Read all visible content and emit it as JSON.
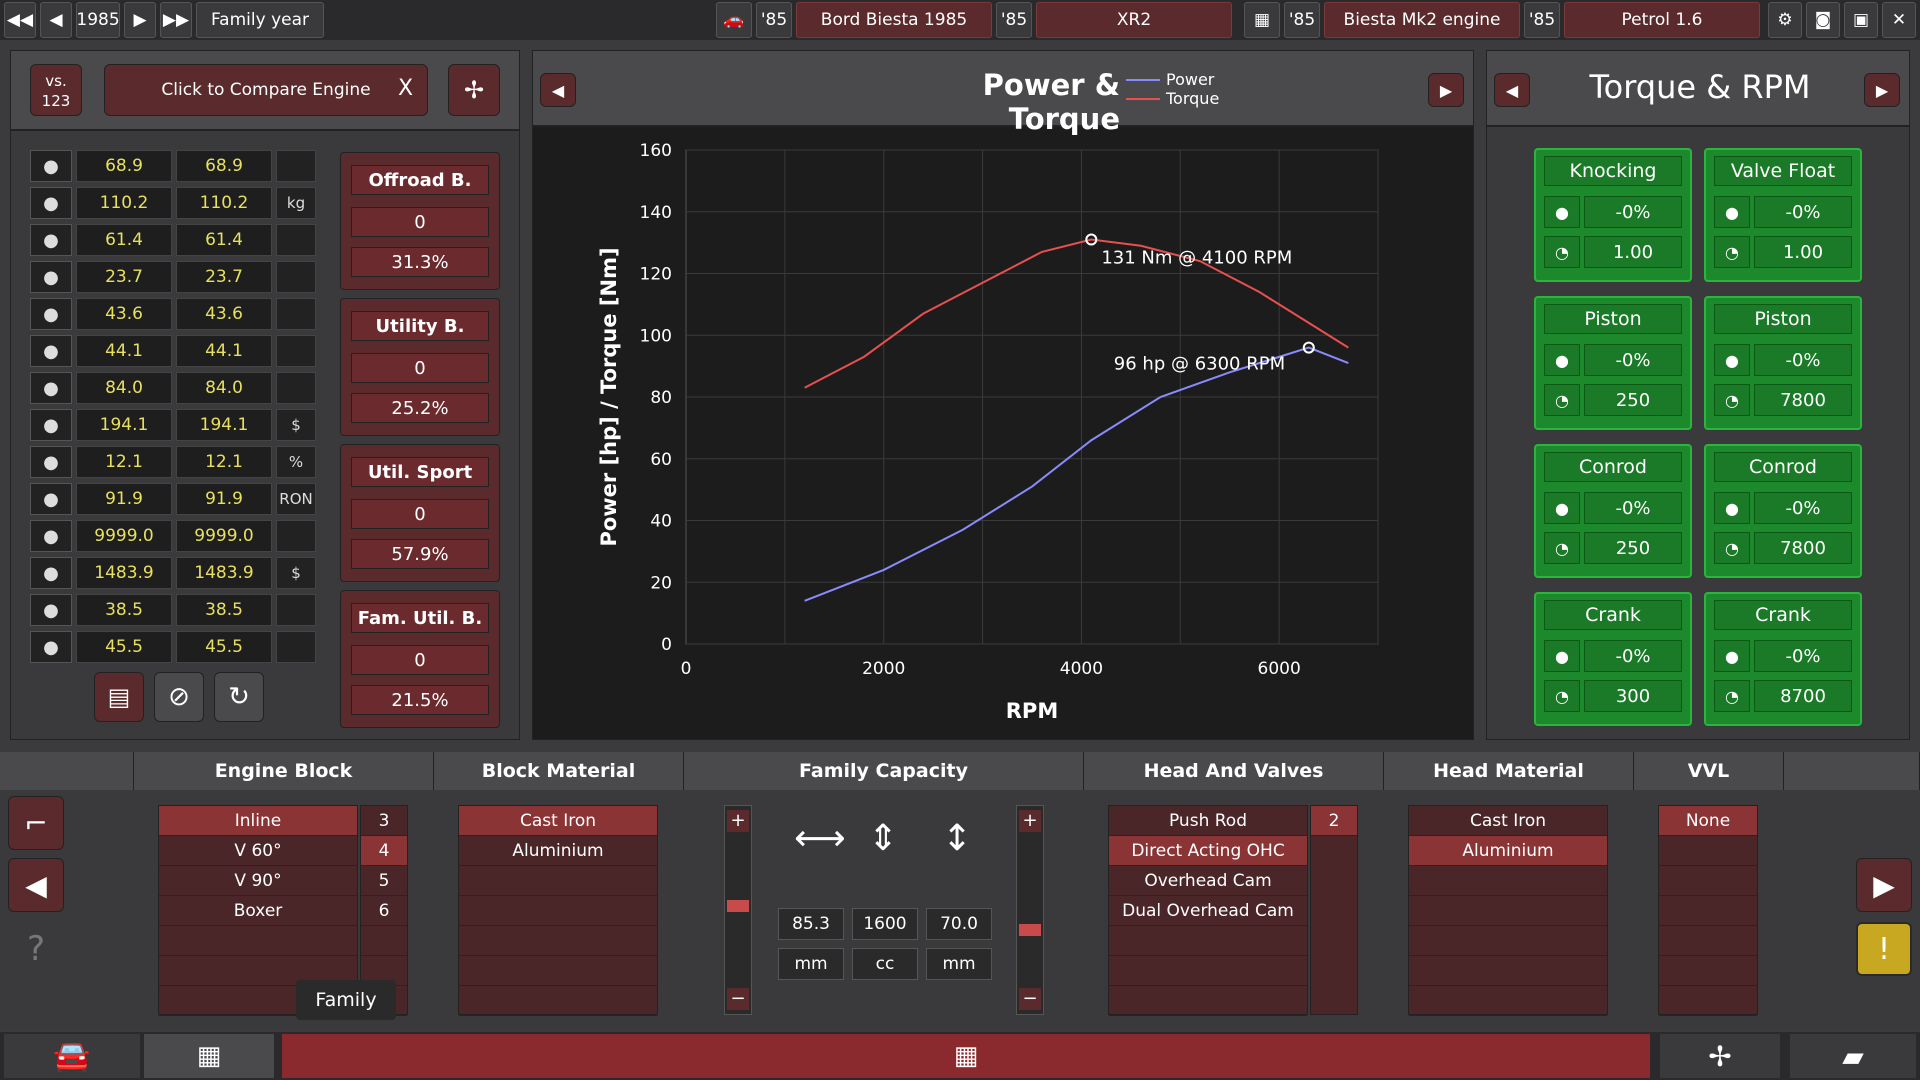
{
  "topbar": {
    "year": "1985",
    "family_label": "Family year",
    "car_year": "'85",
    "car_name": "Bord Biesta 1985",
    "trim_year": "'85",
    "trim_name": "XR2",
    "engine_year": "'85",
    "engine_name": "Biesta Mk2 engine",
    "variant_year": "'85",
    "variant_name": "Petrol 1.6"
  },
  "compare": {
    "vs_label": "vs.\n123",
    "compare_label": "Click to Compare Engine",
    "close_label": "X"
  },
  "stats": [
    {
      "icon": "speedometer-icon",
      "a": "68.9",
      "b": "68.9",
      "unit": ""
    },
    {
      "icon": "weight-icon",
      "a": "110.2",
      "b": "110.2",
      "unit": "kg"
    },
    {
      "icon": "engine-icon",
      "a": "61.4",
      "b": "61.4",
      "unit": ""
    },
    {
      "icon": "smoothness-icon",
      "a": "23.7",
      "b": "23.7",
      "unit": ""
    },
    {
      "icon": "radiator-icon",
      "a": "43.6",
      "b": "43.6",
      "unit": ""
    },
    {
      "icon": "speaker-icon",
      "a": "44.1",
      "b": "44.1",
      "unit": ""
    },
    {
      "icon": "snowflake-icon",
      "a": "84.0",
      "b": "84.0",
      "unit": ""
    },
    {
      "icon": "engine-cost-icon",
      "a": "194.1",
      "b": "194.1",
      "unit": "$"
    },
    {
      "icon": "fuel-can-icon",
      "a": "12.1",
      "b": "12.1",
      "unit": "%"
    },
    {
      "icon": "fuel-pump-icon",
      "a": "91.9",
      "b": "91.9",
      "unit": "RON"
    },
    {
      "icon": "emissions-icon",
      "a": "9999.0",
      "b": "9999.0",
      "unit": ""
    },
    {
      "icon": "worker-icon",
      "a": "1483.9",
      "b": "1483.9",
      "unit": "$"
    },
    {
      "icon": "anvil-icon",
      "a": "38.5",
      "b": "38.5",
      "unit": ""
    },
    {
      "icon": "gears-icon",
      "a": "45.5",
      "b": "45.5",
      "unit": ""
    }
  ],
  "bodies": [
    {
      "title": "Offroad B.",
      "v1": "0",
      "v2": "31.3%"
    },
    {
      "title": "Utility B.",
      "v1": "0",
      "v2": "25.2%"
    },
    {
      "title": "Util. Sport",
      "v1": "0",
      "v2": "57.9%"
    },
    {
      "title": "Fam. Util. B.",
      "v1": "0",
      "v2": "21.5%"
    }
  ],
  "chart_data": {
    "type": "line",
    "title": "Power & Torque",
    "xlabel": "RPM",
    "ylabel": "Power [hp] / Torque [Nm]",
    "xlim": [
      0,
      7000
    ],
    "ylim": [
      0,
      160
    ],
    "xticks": [
      "0",
      "2000",
      "4000",
      "6000"
    ],
    "yticks": [
      "0",
      "20",
      "40",
      "60",
      "80",
      "100",
      "120",
      "140",
      "160"
    ],
    "grid": true,
    "legend": "top-right",
    "series": [
      {
        "name": "Power",
        "color": "#8a8aff",
        "x": [
          1200,
          2000,
          2800,
          3500,
          4100,
          4800,
          5500,
          6000,
          6300,
          6700
        ],
        "y": [
          14,
          24,
          37,
          51,
          66,
          80,
          88,
          93,
          96,
          91
        ]
      },
      {
        "name": "Torque",
        "color": "#e85050",
        "x": [
          1200,
          1800,
          2400,
          3000,
          3600,
          4100,
          4600,
          5200,
          5800,
          6300,
          6700
        ],
        "y": [
          83,
          93,
          107,
          117,
          127,
          131,
          129,
          124,
          114,
          104,
          96
        ]
      }
    ],
    "annotations": [
      "131 Nm @ 4100 RPM",
      "96 hp @ 6300 RPM"
    ]
  },
  "torque_panel": {
    "title": "Torque & RPM",
    "cards": [
      {
        "title": "Knocking",
        "r1": "-0%",
        "r2": "1.00",
        "i2": "knock-icon"
      },
      {
        "title": "Valve Float",
        "r1": "-0%",
        "r2": "1.00",
        "i2": "rpm-gauge-icon"
      },
      {
        "title": "Piston",
        "r1": "-0%",
        "r2": "250",
        "i2": "wrench-icon"
      },
      {
        "title": "Piston",
        "r1": "-0%",
        "r2": "7800",
        "i2": "rpm-gauge-icon"
      },
      {
        "title": "Conrod",
        "r1": "-0%",
        "r2": "250",
        "i2": "wrench-icon"
      },
      {
        "title": "Conrod",
        "r1": "-0%",
        "r2": "7800",
        "i2": "rpm-gauge-icon"
      },
      {
        "title": "Crank",
        "r1": "-0%",
        "r2": "300",
        "i2": "wrench-icon"
      },
      {
        "title": "Crank",
        "r1": "-0%",
        "r2": "8700",
        "i2": "rpm-gauge-icon"
      }
    ]
  },
  "bottom": {
    "engine_block": {
      "title": "Engine Block",
      "options": [
        "Inline",
        "V 60°",
        "V 90°",
        "Boxer"
      ],
      "counts": [
        "3",
        "4",
        "5",
        "6"
      ]
    },
    "block_material": {
      "title": "Block Material",
      "options": [
        "Cast Iron",
        "Aluminium"
      ]
    },
    "family_capacity": {
      "title": "Family Capacity",
      "bore": "85.3",
      "cap": "1600",
      "stroke": "70.0",
      "bore_unit": "mm",
      "cap_unit": "cc",
      "stroke_unit": "mm"
    },
    "head_valves": {
      "title": "Head And Valves",
      "options": [
        "Push Rod",
        "Direct Acting OHC",
        "Overhead Cam",
        "Dual Overhead Cam"
      ],
      "count": "2"
    },
    "head_material": {
      "title": "Head Material",
      "options": [
        "Cast Iron",
        "Aluminium"
      ]
    },
    "vvl": {
      "title": "VVL",
      "options": [
        "None"
      ]
    },
    "tooltip": "Family"
  }
}
